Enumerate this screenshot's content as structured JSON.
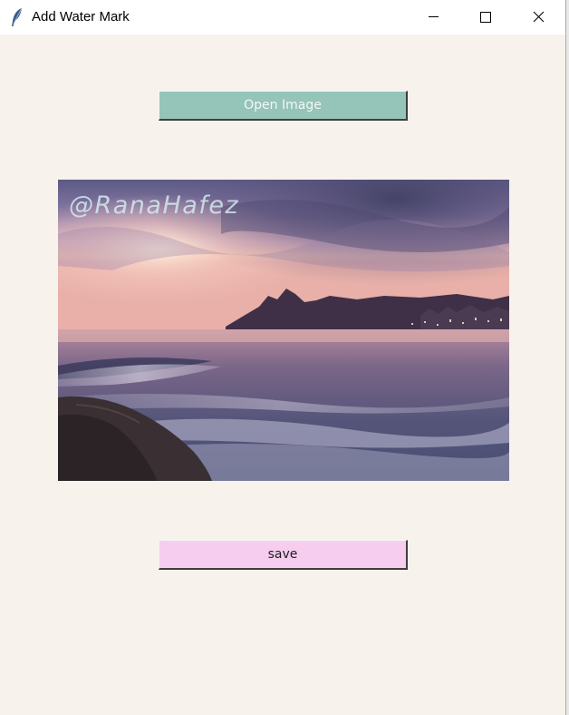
{
  "window": {
    "title": "Add Water Mark",
    "icon": "feather-icon",
    "controls": [
      "minimize-icon",
      "maximize-icon",
      "close-icon"
    ]
  },
  "main": {
    "open_button_label": "Open Image",
    "save_button_label": "save",
    "image": {
      "description_icon": "beach-sunset-photo",
      "watermark_text": "@RanaHafez"
    }
  },
  "colors": {
    "background": "#f7f2ec",
    "open_button": "#95c4b8",
    "save_button": "#f7cdef"
  }
}
